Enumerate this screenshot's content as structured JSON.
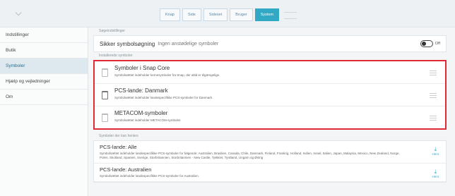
{
  "topbar": {
    "tabs": [
      {
        "label": "Knap",
        "active": false
      },
      {
        "label": "Side",
        "active": false
      },
      {
        "label": "Sideset",
        "active": false
      },
      {
        "label": "Bruger",
        "active": false
      },
      {
        "label": "System",
        "active": true
      }
    ]
  },
  "sidebar": {
    "items": [
      {
        "label": "Indstillinger"
      },
      {
        "label": "Butik"
      },
      {
        "label": "Symboler"
      },
      {
        "label": "Hjælp og vejledninger"
      },
      {
        "label": "Om"
      }
    ]
  },
  "search_settings": {
    "section_label": "Søgeindstillinger",
    "title": "Sikker symbolsøgning",
    "subtitle": "Ingen anstødelige symboler",
    "toggle_label": "Off"
  },
  "installed": {
    "section_label": "Installerede symboler",
    "items": [
      {
        "title": "Symboler i Snap Core",
        "desc": "Symbolsættet indeholder kernesymboler fra Snap, der altid er tilgængelige."
      },
      {
        "title": "PCS-lande: Danmark",
        "desc": "Symbolsættet indeholder landespecifikke PCS-symboler for Danmark."
      },
      {
        "title": "METACOM-symboler",
        "desc": "Symbolsættet indeholder METACOM-symboler."
      }
    ]
  },
  "available": {
    "section_label": "Symboler der kan hentes",
    "download_label": "Hent",
    "items": [
      {
        "title": "PCS-lande: Alle",
        "desc": "Symbolsættet indeholder landespecifikke PCS-symboler for følgende: Australien, Brasilien, Canada, Chile, Danmark, Finland, Frankrig, Holland, Indien, Israel, Italien, Japan, Malaysia, Mexico, New Zealand, Norge, Polen, Skotland, Spanien, Sverige, Storbritannien, Storbritannien - New Castle, Tjekkiet, Tyskland, Ungarn og Østrig"
      },
      {
        "title": "PCS-lande: Australien",
        "desc": "Symbolsættet indeholder landespecifikke PCS-symboler for Australien."
      }
    ]
  }
}
